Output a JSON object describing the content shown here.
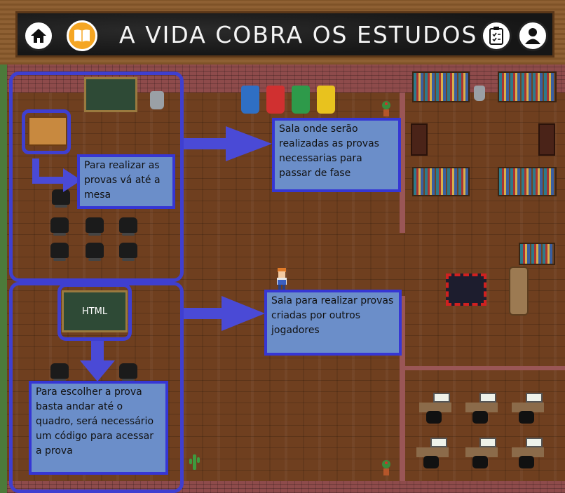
{
  "header": {
    "title": "A VIDA COBRA OS ESTUDOS",
    "buttons": [
      {
        "name": "home",
        "icon": "home-icon"
      },
      {
        "name": "book",
        "icon": "book-icon"
      },
      {
        "name": "tasks",
        "icon": "clipboard-icon"
      },
      {
        "name": "profile",
        "icon": "user-icon"
      }
    ]
  },
  "map": {
    "top_room_note": "Para realizar as provas vá até a mesa",
    "bottom_room_note": "Para escolher a prova basta andar até o quadro, será necessário um código para acessar a prova",
    "exam_room_caption": "Sala onde serão realizadas as provas necessarias para passar de fase",
    "custom_room_caption": "Sala para realizar provas criadas por outros jogadores",
    "chalkboard_label": "HTML"
  },
  "colors": {
    "annotation_blue": "#3f3fd0",
    "note_fill": "#6b8ec9",
    "bin_blue": "#2f6fc4",
    "bin_red": "#d03030",
    "bin_green": "#2e9a4a",
    "bin_yellow": "#e8c21e",
    "book_button": "#f5a623"
  }
}
